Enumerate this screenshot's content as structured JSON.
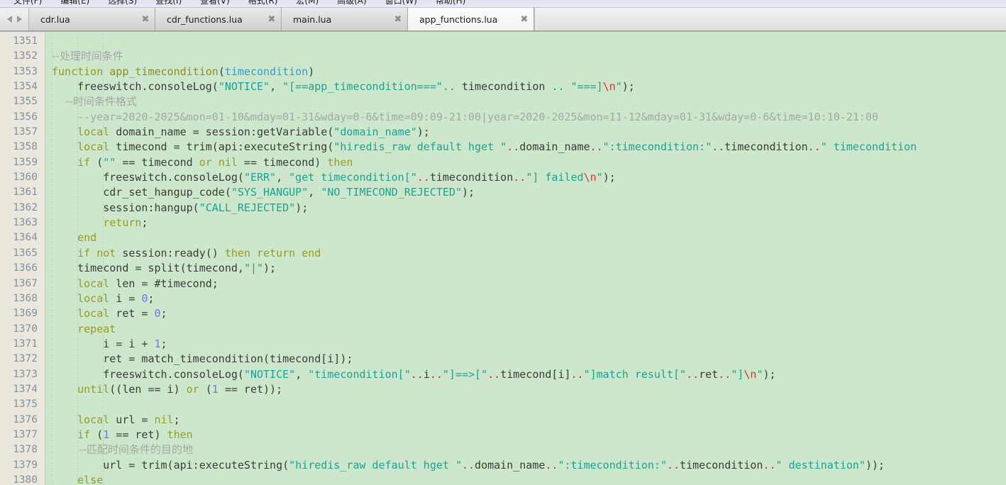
{
  "window": {
    "menubar": {
      "items": [
        "文件(F)",
        "编辑(E)",
        "选择(S)",
        "查找(I)",
        "查看(V)",
        "格式(R)",
        "宏(M)",
        "高级(A)",
        "窗口(W)",
        "帮助(H)"
      ]
    },
    "tabbar": {
      "nav_back_icon": "triangle-left-icon",
      "nav_forward_icon": "triangle-right-icon",
      "close_glyph": "✖",
      "tabs": [
        {
          "label": "cdr.lua",
          "active": false
        },
        {
          "label": "cdr_functions.lua",
          "active": false
        },
        {
          "label": "main.lua",
          "active": false
        },
        {
          "label": "app_functions.lua",
          "active": true
        }
      ]
    }
  },
  "editor": {
    "language": "lua",
    "first_line_number": 1351,
    "last_line_number": 1380,
    "colors": {
      "background": "#cce7cc",
      "gutter_background": "#ece7dc",
      "line_number": "#7e93a3",
      "keyword": "#9a9a1f",
      "string": "#1aa393",
      "comment": "#a6a6a6",
      "number": "#7a6ff0",
      "escape": "#e03030",
      "identifier": "#3b3b3b",
      "parameter": "#2f9ecf"
    },
    "lines": [
      {
        "n": 1351,
        "text": ""
      },
      {
        "n": 1352,
        "text": "--处理时间条件"
      },
      {
        "n": 1353,
        "text": "function app_timecondition(timecondition)"
      },
      {
        "n": 1354,
        "text": "    freeswitch.consoleLog(\"NOTICE\", \"[==app_timecondition===\".. timecondition .. \"===]\\n\");"
      },
      {
        "n": 1355,
        "text": "    --时间条件格式"
      },
      {
        "n": 1356,
        "text": "    --year=2020-2025&mon=01-10&mday=01-31&wday=0-6&time=09:09-21:00|year=2020-2025&mon=11-12&mday=01-31&wday=0-6&time=10:10-21:00"
      },
      {
        "n": 1357,
        "text": "    local domain_name = session:getVariable(\"domain_name\");"
      },
      {
        "n": 1358,
        "text": "    local timecond = trim(api:executeString(\"hiredis_raw default hget \"..domain_name..\":timecondition:\"..timecondition..\" timecondition"
      },
      {
        "n": 1359,
        "text": "    if (\"\" == timecond or nil == timecond) then"
      },
      {
        "n": 1360,
        "text": "        freeswitch.consoleLog(\"ERR\", \"get timecondition[\"..timecondition..\"] failed\\n\");"
      },
      {
        "n": 1361,
        "text": "        cdr_set_hangup_code(\"SYS_HANGUP\", \"NO_TIMECOND_REJECTED\");"
      },
      {
        "n": 1362,
        "text": "        session:hangup(\"CALL_REJECTED\");"
      },
      {
        "n": 1363,
        "text": "        return;"
      },
      {
        "n": 1364,
        "text": "    end"
      },
      {
        "n": 1365,
        "text": "    if not session:ready() then return end"
      },
      {
        "n": 1366,
        "text": "    timecond = split(timecond,\"|\");"
      },
      {
        "n": 1367,
        "text": "    local len = #timecond;"
      },
      {
        "n": 1368,
        "text": "    local i = 0;"
      },
      {
        "n": 1369,
        "text": "    local ret = 0;"
      },
      {
        "n": 1370,
        "text": "    repeat"
      },
      {
        "n": 1371,
        "text": "        i = i + 1;"
      },
      {
        "n": 1372,
        "text": "        ret = match_timecondition(timecond[i]);"
      },
      {
        "n": 1373,
        "text": "        freeswitch.consoleLog(\"NOTICE\", \"timecondition[\"..i..\"]==>[\"..timecond[i]..\"]match result[\"..ret..\"]\\n\");"
      },
      {
        "n": 1374,
        "text": "    until((len == i) or (1 == ret));"
      },
      {
        "n": 1375,
        "text": ""
      },
      {
        "n": 1376,
        "text": "    local url = nil;"
      },
      {
        "n": 1377,
        "text": "    if (1 == ret) then"
      },
      {
        "n": 1378,
        "text": "        --匹配时间条件的目的地"
      },
      {
        "n": 1379,
        "text": "        url = trim(api:executeString(\"hiredis_raw default hget \"..domain_name..\":timecondition:\"..timecondition..\" destination\"));"
      },
      {
        "n": 1380,
        "text": "    else"
      }
    ],
    "rendered_lines": [
      {
        "n": 1351,
        "tokens": []
      },
      {
        "n": 1352,
        "tokens": [
          {
            "t": "--处理时间条件",
            "c": "cmt cjk"
          }
        ]
      },
      {
        "n": 1353,
        "tokens": [
          {
            "t": "function",
            "c": "kw"
          },
          {
            "t": " ",
            "c": "op"
          },
          {
            "t": "app_timecondition",
            "c": "fn"
          },
          {
            "t": "(",
            "c": "op"
          },
          {
            "t": "timecondition",
            "c": "param"
          },
          {
            "t": ")",
            "c": "op"
          }
        ]
      },
      {
        "n": 1354,
        "tokens": [
          {
            "t": "    freeswitch.consoleLog(",
            "c": "id"
          },
          {
            "t": "\"NOTICE\"",
            "c": "str"
          },
          {
            "t": ", ",
            "c": "id"
          },
          {
            "t": "\"[==app_timecondition===\"",
            "c": "str"
          },
          {
            "t": "..",
            "c": "dotg"
          },
          {
            "t": " timecondition ",
            "c": "id"
          },
          {
            "t": "..",
            "c": "dotg"
          },
          {
            "t": " ",
            "c": "id"
          },
          {
            "t": "\"===]",
            "c": "str"
          },
          {
            "t": "\\n",
            "c": "esc"
          },
          {
            "t": "\"",
            "c": "str"
          },
          {
            "t": ");",
            "c": "id"
          }
        ]
      },
      {
        "n": 1355,
        "tokens": [
          {
            "t": "    --时间条件格式",
            "c": "cmt cjk"
          }
        ]
      },
      {
        "n": 1356,
        "tokens": [
          {
            "t": "    --year=2020-2025&mon=01-10&mday=01-31&wday=0-6&time=09:09-21:00|year=2020-2025&mon=11-12&mday=01-31&wday=0-6&time=10:10-21:00",
            "c": "cmt"
          }
        ]
      },
      {
        "n": 1357,
        "tokens": [
          {
            "t": "    ",
            "c": "id"
          },
          {
            "t": "local",
            "c": "kw"
          },
          {
            "t": " domain_name = session:getVariable(",
            "c": "id"
          },
          {
            "t": "\"domain_name\"",
            "c": "str"
          },
          {
            "t": ");",
            "c": "id"
          }
        ]
      },
      {
        "n": 1358,
        "tokens": [
          {
            "t": "    ",
            "c": "id"
          },
          {
            "t": "local",
            "c": "kw"
          },
          {
            "t": " timecond = trim(api:executeString(",
            "c": "id"
          },
          {
            "t": "\"hiredis_raw default hget \"",
            "c": "str"
          },
          {
            "t": "..",
            "c": "dot"
          },
          {
            "t": "domain_name",
            "c": "id"
          },
          {
            "t": "..",
            "c": "dot"
          },
          {
            "t": "\":timecondition:\"",
            "c": "str"
          },
          {
            "t": "..",
            "c": "dot"
          },
          {
            "t": "timecondition",
            "c": "id"
          },
          {
            "t": "..",
            "c": "dot"
          },
          {
            "t": "\" timecondition",
            "c": "str"
          }
        ]
      },
      {
        "n": 1359,
        "tokens": [
          {
            "t": "    ",
            "c": "id"
          },
          {
            "t": "if",
            "c": "kw"
          },
          {
            "t": " (",
            "c": "id"
          },
          {
            "t": "\"\"",
            "c": "str"
          },
          {
            "t": " == timecond ",
            "c": "id"
          },
          {
            "t": "or",
            "c": "kw"
          },
          {
            "t": " ",
            "c": "id"
          },
          {
            "t": "nil",
            "c": "kw"
          },
          {
            "t": " == timecond) ",
            "c": "id"
          },
          {
            "t": "then",
            "c": "kw"
          }
        ]
      },
      {
        "n": 1360,
        "tokens": [
          {
            "t": "        freeswitch.consoleLog(",
            "c": "id"
          },
          {
            "t": "\"ERR\"",
            "c": "str"
          },
          {
            "t": ", ",
            "c": "id"
          },
          {
            "t": "\"get timecondition[\"",
            "c": "str"
          },
          {
            "t": "..",
            "c": "dot"
          },
          {
            "t": "timecondition",
            "c": "id"
          },
          {
            "t": "..",
            "c": "dot"
          },
          {
            "t": "\"] failed",
            "c": "str"
          },
          {
            "t": "\\n",
            "c": "esc"
          },
          {
            "t": "\"",
            "c": "str"
          },
          {
            "t": ");",
            "c": "id"
          }
        ]
      },
      {
        "n": 1361,
        "tokens": [
          {
            "t": "        cdr_set_hangup_code(",
            "c": "id"
          },
          {
            "t": "\"SYS_HANGUP\"",
            "c": "str"
          },
          {
            "t": ", ",
            "c": "id"
          },
          {
            "t": "\"NO_TIMECOND_REJECTED\"",
            "c": "str"
          },
          {
            "t": ");",
            "c": "id"
          }
        ]
      },
      {
        "n": 1362,
        "tokens": [
          {
            "t": "        session:hangup(",
            "c": "id"
          },
          {
            "t": "\"CALL_REJECTED\"",
            "c": "str"
          },
          {
            "t": ");",
            "c": "id"
          }
        ]
      },
      {
        "n": 1363,
        "tokens": [
          {
            "t": "        ",
            "c": "id"
          },
          {
            "t": "return",
            "c": "kw"
          },
          {
            "t": ";",
            "c": "id"
          }
        ]
      },
      {
        "n": 1364,
        "tokens": [
          {
            "t": "    ",
            "c": "id"
          },
          {
            "t": "end",
            "c": "kw"
          }
        ]
      },
      {
        "n": 1365,
        "tokens": [
          {
            "t": "    ",
            "c": "id"
          },
          {
            "t": "if",
            "c": "kw"
          },
          {
            "t": " ",
            "c": "id"
          },
          {
            "t": "not",
            "c": "kw"
          },
          {
            "t": " session:ready() ",
            "c": "id"
          },
          {
            "t": "then",
            "c": "kw"
          },
          {
            "t": " ",
            "c": "id"
          },
          {
            "t": "return",
            "c": "kw"
          },
          {
            "t": " ",
            "c": "id"
          },
          {
            "t": "end",
            "c": "kw"
          }
        ]
      },
      {
        "n": 1366,
        "tokens": [
          {
            "t": "    timecond = split(timecond,",
            "c": "id"
          },
          {
            "t": "\"|\"",
            "c": "str"
          },
          {
            "t": ");",
            "c": "id"
          }
        ]
      },
      {
        "n": 1367,
        "tokens": [
          {
            "t": "    ",
            "c": "id"
          },
          {
            "t": "local",
            "c": "kw"
          },
          {
            "t": " len = #timecond;",
            "c": "id"
          }
        ]
      },
      {
        "n": 1368,
        "tokens": [
          {
            "t": "    ",
            "c": "id"
          },
          {
            "t": "local",
            "c": "kw"
          },
          {
            "t": " i = ",
            "c": "id"
          },
          {
            "t": "0",
            "c": "num"
          },
          {
            "t": ";",
            "c": "id"
          }
        ]
      },
      {
        "n": 1369,
        "tokens": [
          {
            "t": "    ",
            "c": "id"
          },
          {
            "t": "local",
            "c": "kw"
          },
          {
            "t": " ret = ",
            "c": "id"
          },
          {
            "t": "0",
            "c": "num"
          },
          {
            "t": ";",
            "c": "id"
          }
        ]
      },
      {
        "n": 1370,
        "tokens": [
          {
            "t": "    ",
            "c": "id"
          },
          {
            "t": "repeat",
            "c": "kw"
          }
        ]
      },
      {
        "n": 1371,
        "tokens": [
          {
            "t": "        i = i + ",
            "c": "id"
          },
          {
            "t": "1",
            "c": "num"
          },
          {
            "t": ";",
            "c": "id"
          }
        ]
      },
      {
        "n": 1372,
        "tokens": [
          {
            "t": "        ret = match_timecondition(timecond[i]);",
            "c": "id"
          }
        ]
      },
      {
        "n": 1373,
        "tokens": [
          {
            "t": "        freeswitch.consoleLog(",
            "c": "id"
          },
          {
            "t": "\"NOTICE\"",
            "c": "str"
          },
          {
            "t": ", ",
            "c": "id"
          },
          {
            "t": "\"timecondition[\"",
            "c": "str"
          },
          {
            "t": "..",
            "c": "dot"
          },
          {
            "t": "i",
            "c": "id"
          },
          {
            "t": "..",
            "c": "dot"
          },
          {
            "t": "\"]==>[\"",
            "c": "str"
          },
          {
            "t": "..",
            "c": "dot"
          },
          {
            "t": "timecond[i]",
            "c": "id"
          },
          {
            "t": "..",
            "c": "dot"
          },
          {
            "t": "\"]match result[\"",
            "c": "str"
          },
          {
            "t": "..",
            "c": "dot"
          },
          {
            "t": "ret",
            "c": "id"
          },
          {
            "t": "..",
            "c": "dot"
          },
          {
            "t": "\"]",
            "c": "str"
          },
          {
            "t": "\\n",
            "c": "esc"
          },
          {
            "t": "\"",
            "c": "str"
          },
          {
            "t": ");",
            "c": "id"
          }
        ]
      },
      {
        "n": 1374,
        "tokens": [
          {
            "t": "    ",
            "c": "id"
          },
          {
            "t": "until",
            "c": "kw"
          },
          {
            "t": "((len == i) ",
            "c": "id"
          },
          {
            "t": "or",
            "c": "kw"
          },
          {
            "t": " (",
            "c": "id"
          },
          {
            "t": "1",
            "c": "num"
          },
          {
            "t": " == ret));",
            "c": "id"
          }
        ]
      },
      {
        "n": 1375,
        "tokens": []
      },
      {
        "n": 1376,
        "tokens": [
          {
            "t": "    ",
            "c": "id"
          },
          {
            "t": "local",
            "c": "kw"
          },
          {
            "t": " url = ",
            "c": "id"
          },
          {
            "t": "nil",
            "c": "kw"
          },
          {
            "t": ";",
            "c": "id"
          }
        ]
      },
      {
        "n": 1377,
        "tokens": [
          {
            "t": "    ",
            "c": "id"
          },
          {
            "t": "if",
            "c": "kw"
          },
          {
            "t": " (",
            "c": "id"
          },
          {
            "t": "1",
            "c": "num"
          },
          {
            "t": " == ret) ",
            "c": "id"
          },
          {
            "t": "then",
            "c": "kw"
          }
        ]
      },
      {
        "n": 1378,
        "tokens": [
          {
            "t": "        --匹配时间条件的目的地",
            "c": "cmt cjk"
          }
        ]
      },
      {
        "n": 1379,
        "tokens": [
          {
            "t": "        url = trim(api:executeString(",
            "c": "id"
          },
          {
            "t": "\"hiredis_raw default hget \"",
            "c": "str"
          },
          {
            "t": "..",
            "c": "dot"
          },
          {
            "t": "domain_name",
            "c": "id"
          },
          {
            "t": "..",
            "c": "dot"
          },
          {
            "t": "\":timecondition:\"",
            "c": "str"
          },
          {
            "t": "..",
            "c": "dot"
          },
          {
            "t": "timecondition",
            "c": "id"
          },
          {
            "t": "..",
            "c": "dot"
          },
          {
            "t": "\" destination\"",
            "c": "str"
          },
          {
            "t": "));",
            "c": "id"
          }
        ]
      },
      {
        "n": 1380,
        "tokens": [
          {
            "t": "    ",
            "c": "id"
          },
          {
            "t": "else",
            "c": "kw"
          }
        ]
      }
    ]
  }
}
